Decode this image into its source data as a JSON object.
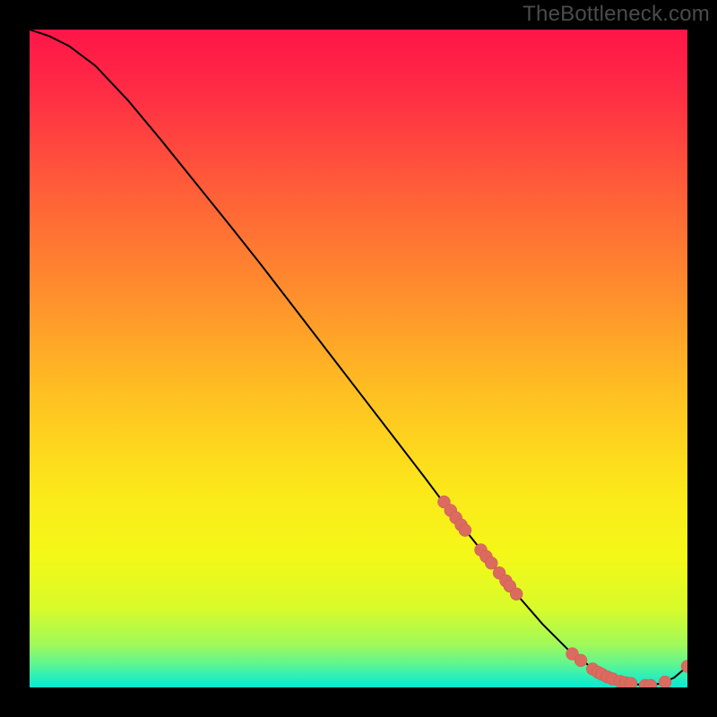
{
  "watermark": "TheBottleneck.com",
  "colors": {
    "background": "#000000",
    "watermark_text": "#4b4b4b",
    "curve": "#000000",
    "point_fill": "#db6a5f",
    "point_stroke": "#c85a50",
    "gradient_stops": [
      {
        "offset": 0.0,
        "color": "#ff1548"
      },
      {
        "offset": 0.1,
        "color": "#ff2e44"
      },
      {
        "offset": 0.25,
        "color": "#ff6038"
      },
      {
        "offset": 0.4,
        "color": "#ff8e2d"
      },
      {
        "offset": 0.55,
        "color": "#ffbf22"
      },
      {
        "offset": 0.7,
        "color": "#fce81a"
      },
      {
        "offset": 0.8,
        "color": "#f4f818"
      },
      {
        "offset": 0.88,
        "color": "#d8fb2a"
      },
      {
        "offset": 0.935,
        "color": "#a0f95a"
      },
      {
        "offset": 0.965,
        "color": "#5ef592"
      },
      {
        "offset": 0.985,
        "color": "#28efbb"
      },
      {
        "offset": 1.0,
        "color": "#0ae8d4"
      }
    ]
  },
  "chart_data": {
    "type": "line",
    "title": "",
    "xlabel": "",
    "ylabel": "",
    "xlim": [
      0,
      100
    ],
    "ylim": [
      0,
      100
    ],
    "series": [
      {
        "name": "bottleneck-curve",
        "x": [
          0,
          3,
          6,
          10,
          15,
          20,
          25,
          30,
          35,
          40,
          45,
          50,
          55,
          60,
          63,
          66,
          70,
          74,
          78,
          82,
          86,
          89,
          92,
          94,
          96,
          98,
          100
        ],
        "y": [
          100,
          99,
          97.5,
          94.5,
          89.2,
          83.2,
          77.0,
          70.8,
          64.5,
          58.0,
          51.5,
          45.0,
          38.5,
          32.0,
          28.0,
          24.2,
          19.2,
          14.2,
          9.6,
          5.6,
          2.6,
          1.2,
          0.5,
          0.3,
          0.6,
          1.5,
          3.2
        ]
      }
    ],
    "points_overlay": [
      {
        "x": 63.0,
        "y": 28.2
      },
      {
        "x": 64.0,
        "y": 26.9
      },
      {
        "x": 64.8,
        "y": 25.8
      },
      {
        "x": 65.6,
        "y": 24.7
      },
      {
        "x": 66.2,
        "y": 23.9
      },
      {
        "x": 68.6,
        "y": 20.9
      },
      {
        "x": 69.4,
        "y": 19.9
      },
      {
        "x": 70.2,
        "y": 18.9
      },
      {
        "x": 71.4,
        "y": 17.4
      },
      {
        "x": 72.4,
        "y": 16.2
      },
      {
        "x": 73.0,
        "y": 15.4
      },
      {
        "x": 74.0,
        "y": 14.2
      },
      {
        "x": 82.5,
        "y": 5.1
      },
      {
        "x": 83.8,
        "y": 4.1
      },
      {
        "x": 85.6,
        "y": 2.8
      },
      {
        "x": 86.4,
        "y": 2.3
      },
      {
        "x": 87.0,
        "y": 2.0
      },
      {
        "x": 87.8,
        "y": 1.6
      },
      {
        "x": 88.6,
        "y": 1.3
      },
      {
        "x": 89.8,
        "y": 0.9
      },
      {
        "x": 90.6,
        "y": 0.7
      },
      {
        "x": 91.4,
        "y": 0.6
      },
      {
        "x": 93.6,
        "y": 0.3
      },
      {
        "x": 94.4,
        "y": 0.3
      },
      {
        "x": 96.6,
        "y": 0.8
      },
      {
        "x": 100.0,
        "y": 3.2
      }
    ]
  }
}
